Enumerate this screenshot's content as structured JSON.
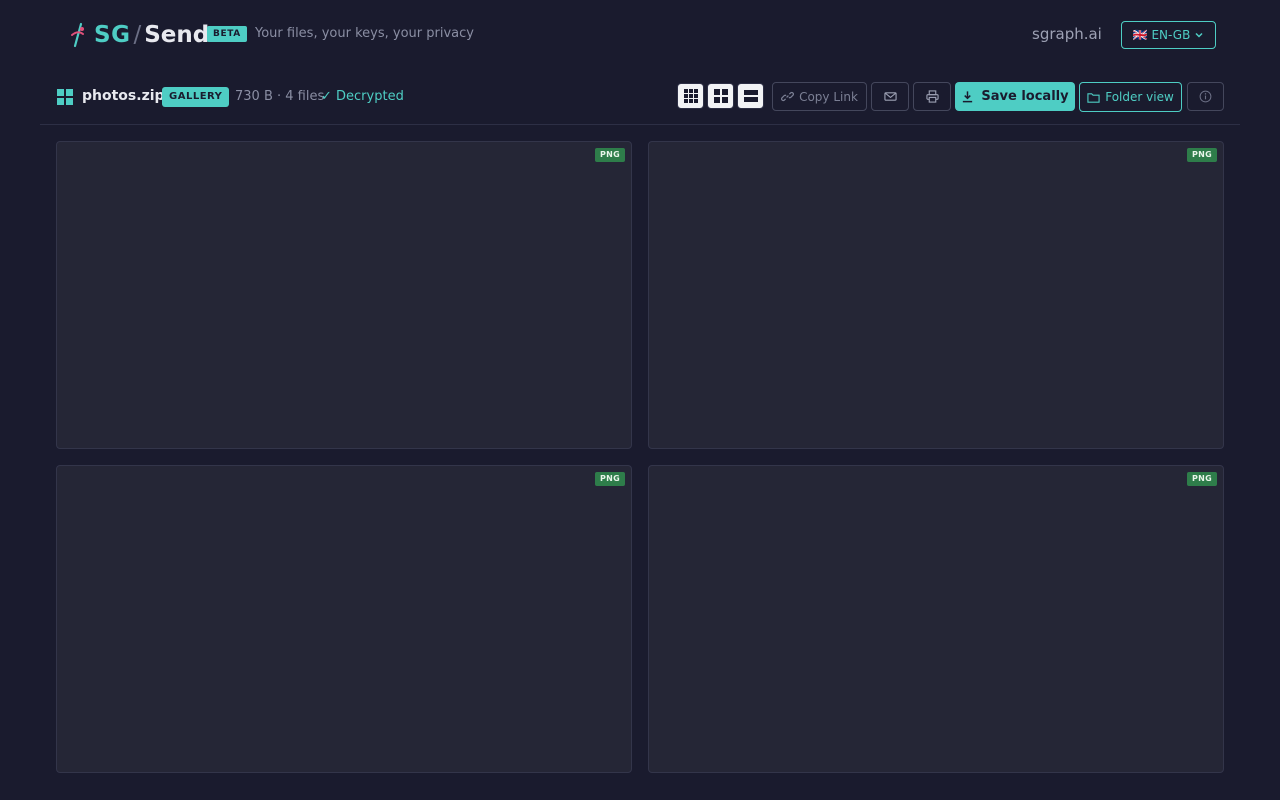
{
  "header": {
    "brand_sg": "SG",
    "brand_slash": "/",
    "brand_send": "Send",
    "beta_label": "BETA",
    "tagline": "Your files, your keys, your privacy",
    "site_link": "sgraph.ai",
    "language": "🇬🇧 EN-GB",
    "accent_color": "#4ecdc4"
  },
  "toolbar": {
    "file_name": "photos.zip",
    "mode_badge": "GALLERY",
    "file_meta": "730 B · 4 files",
    "status": "✓ Decrypted",
    "view_modes": [
      "grid-small-icon",
      "grid-large-icon",
      "list-icon"
    ],
    "copy_link_label": "Copy Link",
    "save_label": "Save locally",
    "folder_view_label": "Folder view"
  },
  "gallery": {
    "items": [
      {
        "type_badge": "PNG"
      },
      {
        "type_badge": "PNG"
      },
      {
        "type_badge": "PNG"
      },
      {
        "type_badge": "PNG"
      }
    ]
  }
}
